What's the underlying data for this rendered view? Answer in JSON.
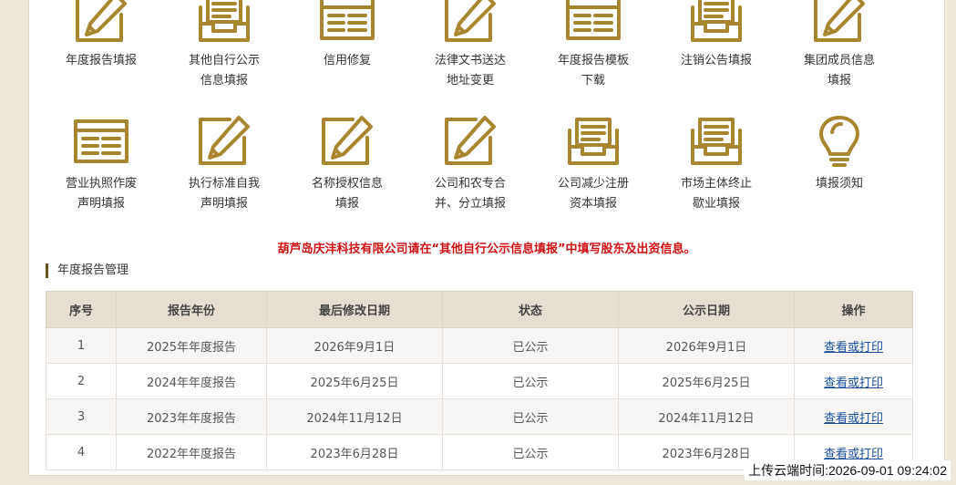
{
  "icons_row1": [
    {
      "icon": "edit-icon",
      "label_lines": [
        "年度报告填报"
      ]
    },
    {
      "icon": "inbox-icon",
      "label_lines": [
        "其他自行公示",
        "信息填报"
      ]
    },
    {
      "icon": "form-list-icon",
      "label_lines": [
        "信用修复"
      ]
    },
    {
      "icon": "edit-icon",
      "label_lines": [
        "法律文书送达",
        "地址变更"
      ]
    },
    {
      "icon": "form-list-icon",
      "label_lines": [
        "年度报告模板",
        "下载"
      ]
    },
    {
      "icon": "inbox-icon",
      "label_lines": [
        "注销公告填报"
      ]
    },
    {
      "icon": "edit-icon",
      "label_lines": [
        "集团成员信息",
        "填报"
      ]
    }
  ],
  "icons_row2": [
    {
      "icon": "form-list-icon",
      "label_lines": [
        "营业执照作废",
        "声明填报"
      ]
    },
    {
      "icon": "edit-icon",
      "label_lines": [
        "执行标准自我",
        "声明填报"
      ]
    },
    {
      "icon": "edit-icon",
      "label_lines": [
        "名称授权信息",
        "填报"
      ]
    },
    {
      "icon": "edit-icon",
      "label_lines": [
        "公司和农专合",
        "并、分立填报"
      ]
    },
    {
      "icon": "inbox-icon",
      "label_lines": [
        "公司减少注册",
        "资本填报"
      ]
    },
    {
      "icon": "inbox-icon",
      "label_lines": [
        "市场主体终止",
        "歇业填报"
      ]
    },
    {
      "icon": "lightbulb-icon",
      "label_lines": [
        "填报须知"
      ]
    }
  ],
  "notice": "葫芦岛庆沣科技有限公司请在“其他自行公示信息填报”中填写股东及出资信息。",
  "section_title": "年度报告管理",
  "table": {
    "headers": [
      "序号",
      "报告年份",
      "最后修改日期",
      "状态",
      "公示日期",
      "操作"
    ],
    "rows": [
      [
        "1",
        "2025年年度报告",
        "2026年9月1日",
        "已公示",
        "2026年9月1日",
        "查看或打印"
      ],
      [
        "2",
        "2024年年度报告",
        "2025年6月25日",
        "已公示",
        "2025年6月25日",
        "查看或打印"
      ],
      [
        "3",
        "2023年年度报告",
        "2024年11月12日",
        "已公示",
        "2024年11月12日",
        "查看或打印"
      ],
      [
        "4",
        "2022年年度报告",
        "2023年6月28日",
        "已公示",
        "2023年6月28日",
        "查看或打印"
      ]
    ]
  },
  "upload_time": "上传云端时间:2026-09-01 09:24:02",
  "colors": {
    "icon_gold": "#a8852f",
    "notice_red": "#d01010",
    "link_blue": "#1a4fa0"
  }
}
